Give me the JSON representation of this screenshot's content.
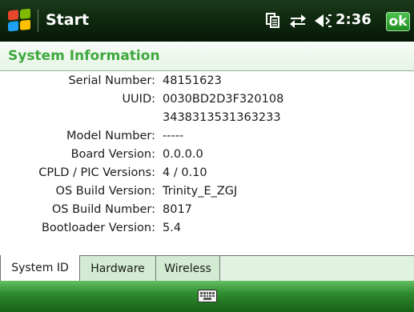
{
  "statusbar": {
    "start_label": "Start",
    "time": "2:36",
    "ok_label": "ok",
    "flag_colors": [
      "#e9472b",
      "#7fba00",
      "#1ea0f0",
      "#ffc000"
    ]
  },
  "page": {
    "title": "System Information"
  },
  "info": {
    "rows": [
      {
        "label": "Serial Number:",
        "value": "48151623"
      },
      {
        "label": "UUID:",
        "value": "0030BD2D3F320108"
      },
      {
        "label": "",
        "value": "3438313531363233"
      },
      {
        "label": "Model Number:",
        "value": "-----"
      },
      {
        "label": "Board Version:",
        "value": "0.0.0.0"
      },
      {
        "label": "CPLD / PIC Versions:",
        "value": "4 / 0.10"
      },
      {
        "label": "OS Build Version:",
        "value": "Trinity_E_ZGJ"
      },
      {
        "label": "OS Build Number:",
        "value": "8017"
      },
      {
        "label": "Bootloader Version:",
        "value": "5.4"
      }
    ]
  },
  "tabs": [
    {
      "label": "System ID",
      "active": true
    },
    {
      "label": "Hardware",
      "active": false
    },
    {
      "label": "Wireless",
      "active": false
    }
  ],
  "icons": {
    "windows_flag": "windows-flag-icon",
    "tasks": "tasks-icon",
    "connectivity": "connectivity-icon",
    "volume": "volume-icon",
    "keyboard": "keyboard-icon"
  }
}
